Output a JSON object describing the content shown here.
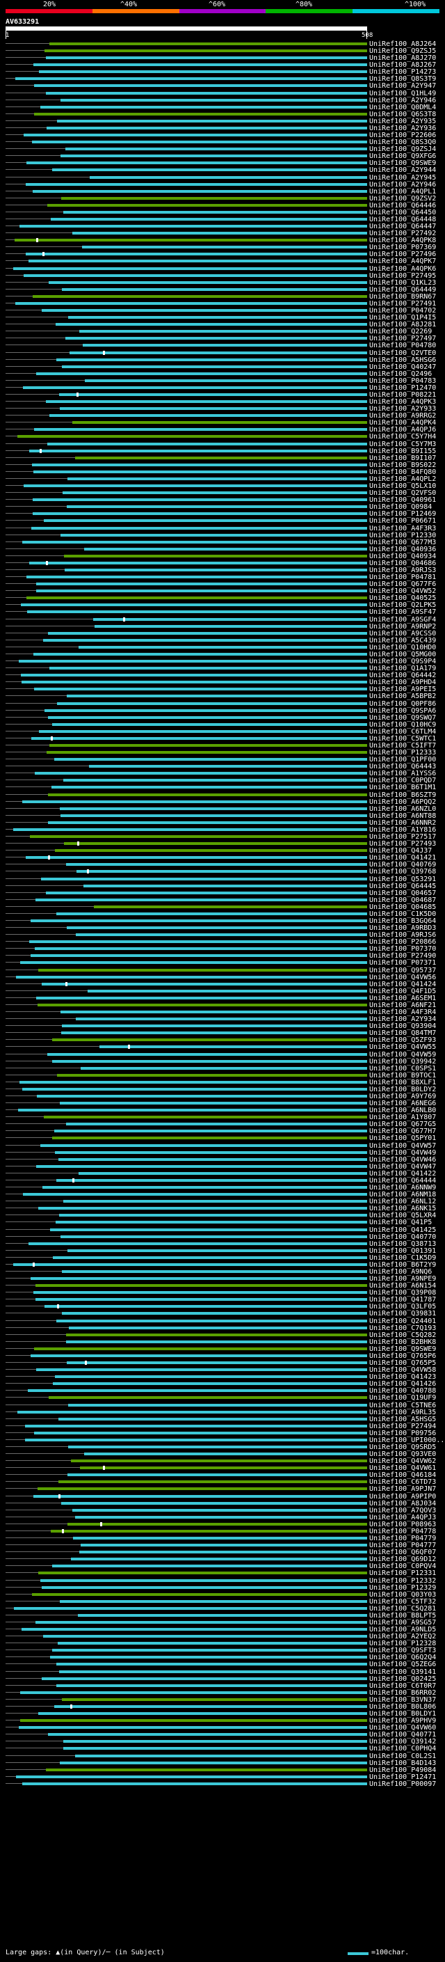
{
  "scale": {
    "labels": [
      {
        "text": "20%",
        "pos": 0.118
      },
      {
        "text": "^40%",
        "pos": 0.242
      },
      {
        "text": "^60%",
        "pos": 0.367
      },
      {
        "text": "^80%",
        "pos": 0.49
      },
      {
        "text": "^100%",
        "pos": 0.6
      }
    ],
    "colors": [
      "#e8001e",
      "#ff7000",
      "#a000c8",
      "#00b400",
      "#00c8dc"
    ]
  },
  "query": {
    "name": "AV633291",
    "start": "1",
    "end": "508"
  },
  "hit_color": "#3cc8d7",
  "low_color": "#5aa000",
  "hits": [
    "UniRef100_A8J264",
    "UniRef100_Q9ZSJ5",
    "UniRef100_A8J270",
    "UniRef100_A8J267",
    "UniRef100_P14273",
    "UniRef100_Q8S3T9",
    "UniRef100_A2Y947",
    "UniRef100_Q1HL49",
    "UniRef100_A2Y946",
    "UniRef100_Q0DML4",
    "UniRef100_Q6S3T8",
    "UniRef100_A2Y935",
    "UniRef100_A2Y936",
    "UniRef100_P22606",
    "UniRef100_Q8S3Q0",
    "UniRef100_Q9ZSJ4",
    "UniRef100_Q9XFG6",
    "UniRef100_Q9SWE9",
    "UniRef100_A2Y944",
    "UniRef100_A2Y945",
    "UniRef100_A2Y946",
    "UniRef100_A4QPL1",
    "UniRef100_Q9ZSV2",
    "UniRef100_Q64446",
    "UniRef100_Q64450",
    "UniRef100_Q64448",
    "UniRef100_Q64447",
    "UniRef100_P27492",
    "UniRef100_A4QPK8",
    "UniRef100_P07369",
    "UniRef100_P27496",
    "UniRef100_A4QPK7",
    "UniRef100_A4QPK6",
    "UniRef100_P27495",
    "UniRef100_Q1KL23",
    "UniRef100_Q64449",
    "UniRef100_B9RN67",
    "UniRef100_P27491",
    "UniRef100_P04702",
    "UniRef100_Q1P4I5",
    "UniRef100_A8J281",
    "UniRef100_Q2269",
    "UniRef100_P27497",
    "UniRef100_P04780",
    "UniRef100_Q2VTE0",
    "UniRef100_A5HSG6",
    "UniRef100_Q40247",
    "UniRef100_Q2496",
    "UniRef100_P04783",
    "UniRef100_P12470",
    "UniRef100_P08221",
    "UniRef100_A4QPK3",
    "UniRef100_A2Y933",
    "UniRef100_A9RRG2",
    "UniRef100_A4QPK4",
    "UniRef100_A4QPJ6",
    "UniRef100_C5Y7H4",
    "UniRef100_C5Y7M3",
    "UniRef100_B9I155",
    "UniRef100_B9I107",
    "UniRef100_B9S022",
    "UniRef100_B4FQ80",
    "UniRef100_A4QPL2",
    "UniRef100_Q5LX10",
    "UniRef100_Q2VFS0",
    "UniRef100_Q40961",
    "UniRef100_Q0984",
    "UniRef100_P12469",
    "UniRef100_P06671",
    "UniRef100_A4F3R3",
    "UniRef100_P12330",
    "UniRef100_Q677M3",
    "UniRef100_Q40936",
    "UniRef100_Q40934",
    "UniRef100_Q04686",
    "UniRef100_A9RJS3",
    "UniRef100_P04781",
    "UniRef100_Q677F6",
    "UniRef100_Q4VW52",
    "UniRef100_Q40525",
    "UniRef100_Q2LPK5",
    "UniRef100_A9SF47",
    "UniRef100_A9SGF4",
    "UniRef100_A9RNP2",
    "UniRef100_A9CSS0",
    "UniRef100_A5C439",
    "UniRef100_Q10HD0",
    "UniRef100_Q5MG00",
    "UniRef100_Q9S9P4",
    "UniRef100_Q1A179",
    "UniRef100_Q64442",
    "UniRef100_A9PHD4",
    "UniRef100_A9PEI5",
    "UniRef100_A5BPB2",
    "UniRef100_Q0PF86",
    "UniRef100_Q9SPA6",
    "UniRef100_Q9SWQ7",
    "UniRef100_Q10HC9",
    "UniRef100_C6TLM4",
    "UniRef100_C5WTC1",
    "UniRef100_C5IFT7",
    "UniRef100_P12333",
    "UniRef100_Q1PF00",
    "UniRef100_Q64443",
    "UniRef100_A1YSS6",
    "UniRef100_C0PQD7",
    "UniRef100_B6T1M1",
    "UniRef100_B6SZT9",
    "UniRef100_A6PQQ2",
    "UniRef100_A6NZL0",
    "UniRef100_A6NT88",
    "UniRef100_A6NNR2",
    "UniRef100_A1Y816",
    "UniRef100_P27517",
    "UniRef100_P27493",
    "UniRef100_Q4J37",
    "UniRef100_Q41421",
    "UniRef100_Q40769",
    "UniRef100_Q39768",
    "UniRef100_Q53291",
    "UniRef100_Q64445",
    "UniRef100_Q04657",
    "UniRef100_Q04687",
    "UniRef100_Q04685",
    "UniRef100_C1K5D0",
    "UniRef100_B3GQ64",
    "UniRef100_A9RBD3",
    "UniRef100_A9RJS6",
    "UniRef100_P20866",
    "UniRef100_P07370",
    "UniRef100_P27490",
    "UniRef100_P07371",
    "UniRef100_Q95737",
    "UniRef100_Q4VW56",
    "UniRef100_Q41424",
    "UniRef100_Q4F1D5",
    "UniRef100_A6SEM1",
    "UniRef100_A6NF21",
    "UniRef100_A4F3R4",
    "UniRef100_A2Y934",
    "UniRef100_Q93904",
    "UniRef100_Q84TM7",
    "UniRef100_Q5ZF93",
    "UniRef100_Q4VW55",
    "UniRef100_Q4VW59",
    "UniRef100_Q39942",
    "UniRef100_C0SPS1",
    "UniRef100_B9TOC1",
    "UniRef100_B8XLF1",
    "UniRef100_B0LDY2",
    "UniRef100_A9Y769",
    "UniRef100_A6NEG6",
    "UniRef100_A6NLB0",
    "UniRef100_A1Y807",
    "UniRef100_Q677G5",
    "UniRef100_Q677H7",
    "UniRef100_Q5PY01",
    "UniRef100_Q4VW57",
    "UniRef100_Q4VW49",
    "UniRef100_Q4VW46",
    "UniRef100_Q4VW47",
    "UniRef100_Q41422",
    "UniRef100_Q64444",
    "UniRef100_A6NNW9",
    "UniRef100_A6NM18",
    "UniRef100_A6NL12",
    "UniRef100_A6NK15",
    "UniRef100_Q5LXR4",
    "UniRef100_Q41P5",
    "UniRef100_Q41425",
    "UniRef100_Q40770",
    "UniRef100_Q38713",
    "UniRef100_Q01391",
    "UniRef100_C1K5D9",
    "UniRef100_B6T2Y9",
    "UniRef100_A9NQ6",
    "UniRef100_A9NPE9",
    "UniRef100_A6N154",
    "UniRef100_Q39P08",
    "UniRef100_Q41787",
    "UniRef100_Q3LF05",
    "UniRef100_Q39831",
    "UniRef100_Q24401",
    "UniRef100_C7Q193",
    "UniRef100_C5Q282",
    "UniRef100_B2BHK8",
    "UniRef100_Q9SWE9",
    "UniRef100_Q765P6",
    "UniRef100_Q765P5",
    "UniRef100_Q4VW58",
    "UniRef100_Q41423",
    "UniRef100_Q41426",
    "UniRef100_Q40788",
    "UniRef100_Q19UF9",
    "UniRef100_C5TNE6",
    "UniRef100_A9RL35",
    "UniRef100_A5HSG5",
    "UniRef100_P27494",
    "UniRef100_P09756",
    "UniRef100_UPI000...",
    "UniRef100_Q9SRD5",
    "UniRef100_Q93VE0",
    "UniRef100_Q4VW62",
    "UniRef100_Q4VW61",
    "UniRef100_Q46184",
    "UniRef100_C6TD73",
    "UniRef100_A9PJN7",
    "UniRef100_A9PIP0",
    "UniRef100_A8J034",
    "UniRef100_A7QOV3",
    "UniRef100_A4QPJ3",
    "UniRef100_P08963",
    "UniRef100_P04778",
    "UniRef100_P04779",
    "UniRef100_P04777",
    "UniRef100_Q6QF07",
    "UniRef100_Q69D12",
    "UniRef100_C0PQV4",
    "UniRef100_P12331",
    "UniRef100_P12332",
    "UniRef100_P12329",
    "UniRef100_Q03Y03",
    "UniRef100_C5TF32",
    "UniRef100_C5Q281",
    "UniRef100_B8LPT5",
    "UniRef100_A9SG57",
    "UniRef100_A9NLD5",
    "UniRef100_A2YEQ2",
    "UniRef100_P12328",
    "UniRef100_Q9SFT3",
    "UniRef100_Q6Q2Q4",
    "UniRef100_Q5ZEG6",
    "UniRef100_Q39141",
    "UniRef100_Q02425",
    "UniRef100_C6T0R7",
    "UniRef100_B6RR02",
    "UniRef100_B3VN37",
    "UniRef100_B0L806",
    "UniRef100_B0LDY1",
    "UniRef100_A9PHV9",
    "UniRef100_Q4VW60",
    "UniRef100_Q40771",
    "UniRef100_Q39142",
    "UniRef100_C0PHQ4",
    "UniRef100_C0L2S1",
    "UniRef100_B4D143",
    "UniRef100_P49084",
    "UniRef100_P12471",
    "UniRef100_P00097"
  ],
  "legend": {
    "text": "Large gaps: ▲(in Query)/─ (in Subject)",
    "scale_text": "=100char."
  }
}
